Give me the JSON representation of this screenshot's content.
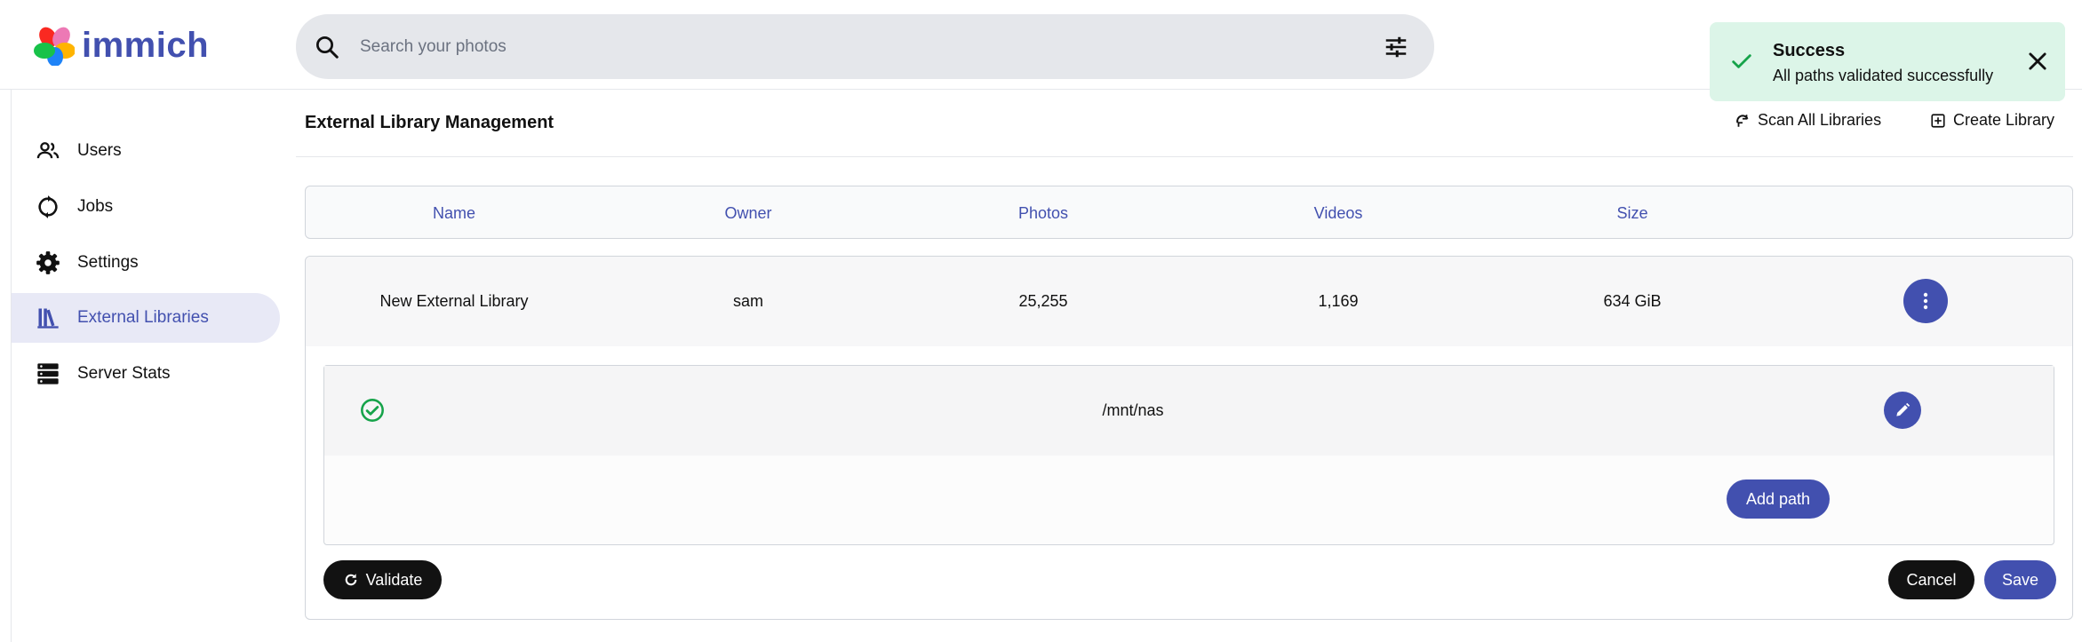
{
  "app": {
    "name": "immich"
  },
  "search": {
    "placeholder": "Search your photos",
    "icon": "search-icon",
    "filter_icon": "tune-icon"
  },
  "sidebar": {
    "items": [
      {
        "label": "Users",
        "icon": "users-icon",
        "active": false
      },
      {
        "label": "Jobs",
        "icon": "sync-icon",
        "active": false
      },
      {
        "label": "Settings",
        "icon": "gear-icon",
        "active": false
      },
      {
        "label": "External Libraries",
        "icon": "library-shelf-icon",
        "active": true
      },
      {
        "label": "Server Stats",
        "icon": "server-icon",
        "active": false
      }
    ]
  },
  "page": {
    "title": "External Library Management",
    "scan_all_label": "Scan All Libraries",
    "create_label": "Create Library"
  },
  "table": {
    "columns": [
      "Name",
      "Owner",
      "Photos",
      "Videos",
      "Size"
    ],
    "rows": [
      {
        "name": "New External Library",
        "owner": "sam",
        "photos": "25,255",
        "videos": "1,169",
        "size": "634 GiB"
      }
    ]
  },
  "paths": {
    "items": [
      {
        "path": "/mnt/nas",
        "valid": true
      }
    ],
    "add_label": "Add path"
  },
  "actions": {
    "validate_label": "Validate",
    "cancel_label": "Cancel",
    "save_label": "Save"
  },
  "toast": {
    "title": "Success",
    "message": "All paths validated successfully"
  },
  "colors": {
    "brand": "#4250af",
    "active_bg": "#e8e9f6",
    "success": "#16a34a",
    "toast_bg": "#dcf5e8",
    "dark_button": "#121212"
  }
}
